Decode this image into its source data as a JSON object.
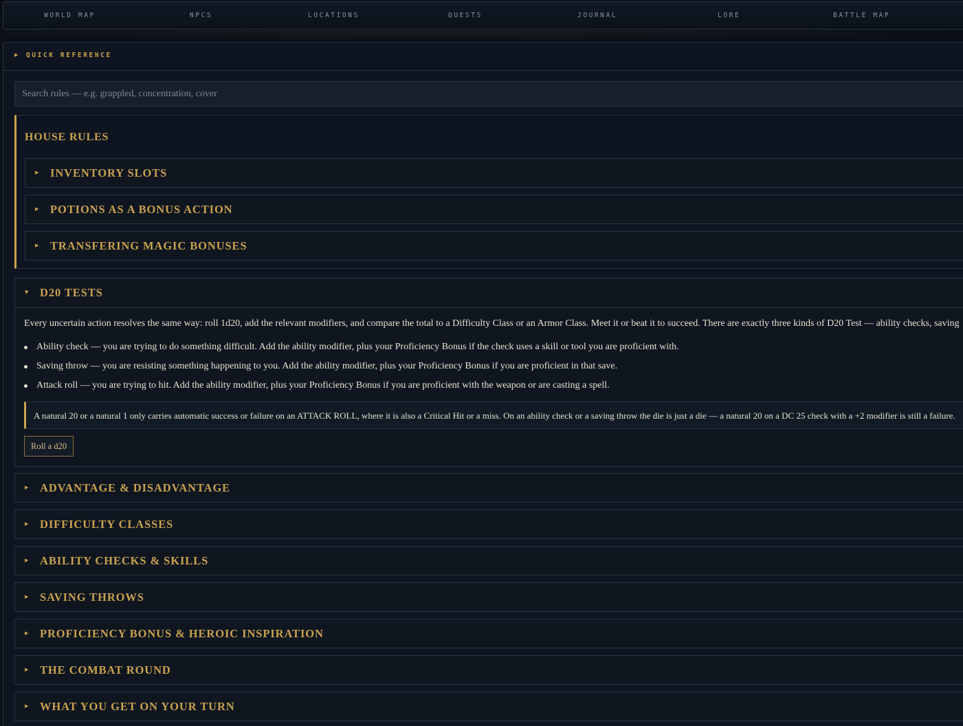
{
  "nav": {
    "items": [
      "WORLD MAP",
      "NPCS",
      "LOCATIONS",
      "QUESTS",
      "JOURNAL",
      "LORE",
      "BATTLE MAP"
    ]
  },
  "panel": {
    "title": "QUICK REFERENCE",
    "search_placeholder": "Search rules — e.g. grappled, concentration, cover"
  },
  "house_rules": {
    "title": "HOUSE RULES",
    "items": [
      "INVENTORY SLOTS",
      "POTIONS AS A BONUS ACTION",
      "TRANSFERING MAGIC BONUSES"
    ]
  },
  "d20": {
    "title": "D20 TESTS",
    "intro": "Every uncertain action resolves the same way: roll 1d20, add the relevant modifiers, and compare the total to a Difficulty Class or an Armor Class. Meet it or beat it to succeed. There are exactly three kinds of D20 Test — ability checks, saving",
    "bullets": [
      "Ability check — you are trying to do something difficult. Add the ability modifier, plus your Proficiency Bonus if the check uses a skill or tool you are proficient with.",
      "Saving throw — you are resisting something happening to you. Add the ability modifier, plus your Proficiency Bonus if you are proficient in that save.",
      "Attack roll — you are trying to hit. Add the ability modifier, plus your Proficiency Bonus if you are proficient with the weapon or are casting a spell."
    ],
    "callout": "A natural 20 or a natural 1 only carries automatic success or failure on an ATTACK ROLL, where it is also a Critical Hit or a miss. On an ability check or a saving throw the die is just a die — a natural 20 on a DC 25 check with a +2 modifier is still a failure.",
    "roll_button": "Roll a d20"
  },
  "sections": [
    "ADVANTAGE & DISADVANTAGE",
    "DIFFICULTY CLASSES",
    "ABILITY CHECKS & SKILLS",
    "SAVING THROWS",
    "PROFICIENCY BONUS & HEROIC INSPIRATION",
    "THE COMBAT ROUND",
    "WHAT YOU GET ON YOUR TURN"
  ],
  "icons": {
    "collapsed": "caret-right-icon",
    "expanded": "caret-down-icon"
  },
  "colors": {
    "accent_gold": "#c9a24e",
    "background": "#0b1018",
    "panel": "#0e1520",
    "text": "#e3ddd0"
  }
}
